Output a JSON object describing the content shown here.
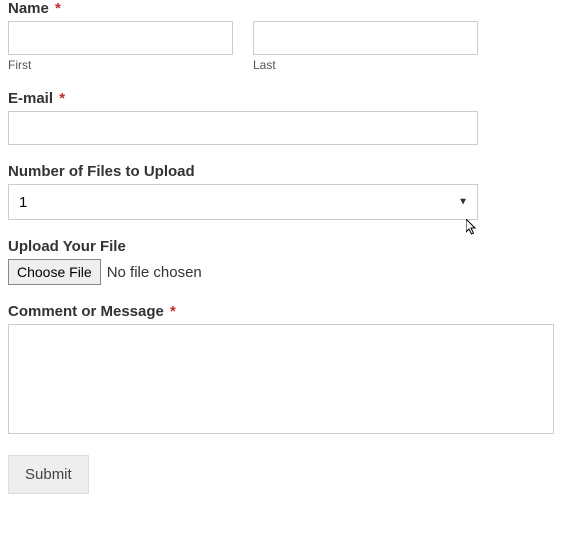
{
  "name_label": "Name",
  "first_sublabel": "First",
  "last_sublabel": "Last",
  "email_label": "E-mail",
  "numfiles_label": "Number of Files to Upload",
  "numfiles_value": "1",
  "upload_label": "Upload Your File",
  "choose_file_btn": "Choose File",
  "no_file_text": "No file chosen",
  "comment_label": "Comment or Message",
  "submit_label": "Submit",
  "required_mark": "*"
}
